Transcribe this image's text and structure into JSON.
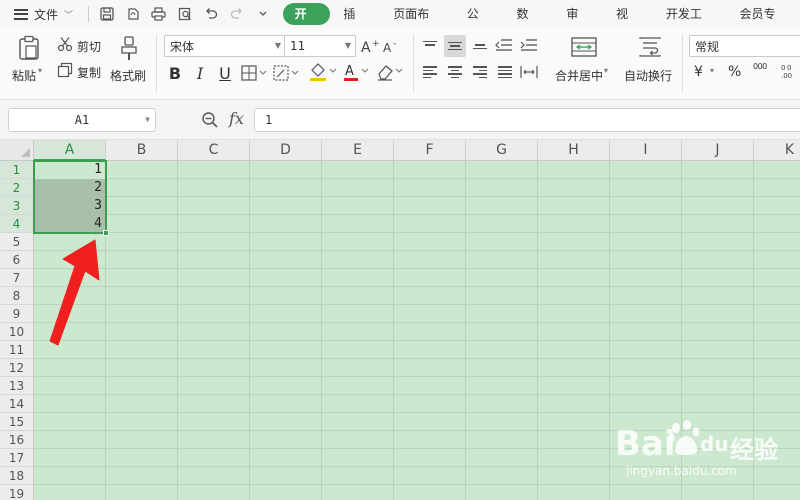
{
  "menubar": {
    "file_label": "文件",
    "tabs": [
      "开始",
      "插入",
      "页面布局",
      "公式",
      "数据",
      "审阅",
      "视图",
      "开发工具",
      "会员专享"
    ],
    "active_tab": "开始"
  },
  "ribbon": {
    "paste_label": "粘贴",
    "cut_label": "剪切",
    "copy_label": "复制",
    "format_painter_label": "格式刷",
    "font_name": "宋体",
    "font_size": "11",
    "bold": "B",
    "italic": "I",
    "underline": "U",
    "merge_center_label": "合并居中",
    "wrap_text_label": "自动换行",
    "number_format": "常规",
    "currency_symbol": "¥",
    "percent_symbol": "%",
    "thousands_symbol": "000",
    "font_color": "#e02020",
    "highlight_color": "#f2c200"
  },
  "formula_bar": {
    "name_box": "A1",
    "fx_label": "fx",
    "formula_value": "1"
  },
  "grid": {
    "columns": [
      "A",
      "B",
      "C",
      "D",
      "E",
      "F",
      "G",
      "H",
      "I",
      "J",
      "K"
    ],
    "rows": [
      "1",
      "2",
      "3",
      "4",
      "5",
      "6",
      "7",
      "8",
      "9",
      "10",
      "11",
      "12",
      "13",
      "14",
      "15",
      "16",
      "17",
      "18",
      "19"
    ],
    "cells": [
      {
        "ref": "A1",
        "value": "1"
      },
      {
        "ref": "A2",
        "value": "2"
      },
      {
        "ref": "A3",
        "value": "3"
      },
      {
        "ref": "A4",
        "value": "4"
      }
    ],
    "selected_range": "A1:A4",
    "background_color": "#cce8cf"
  },
  "annotation": {
    "arrow_color": "#f02020"
  },
  "watermark": {
    "brand": "Bai",
    "brand_suffix": "du",
    "service": "经验",
    "url": "jingyan.baidu.com"
  }
}
